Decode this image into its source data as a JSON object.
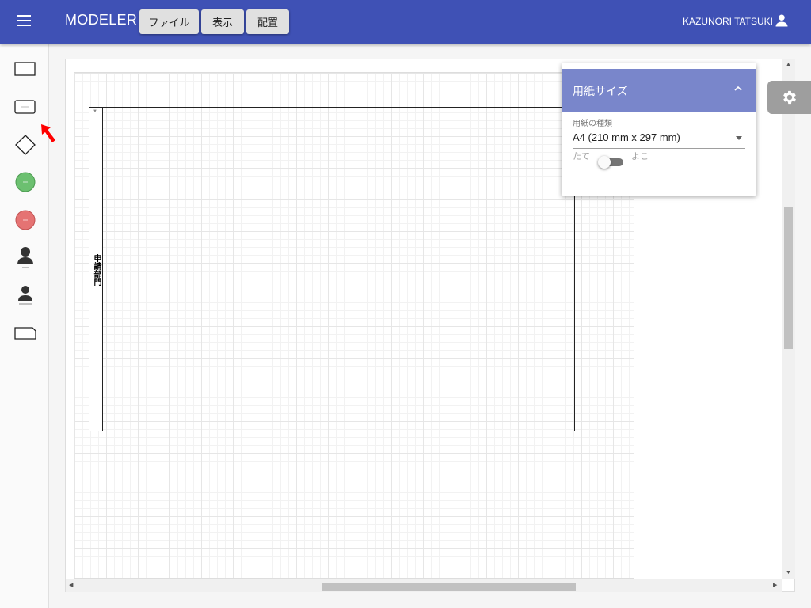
{
  "header": {
    "title": "MODELER",
    "menus": [
      {
        "label": "ファイル"
      },
      {
        "label": "表示"
      },
      {
        "label": "配置"
      }
    ],
    "user_name": "KAZUNORI TATSUKI"
  },
  "palette": {
    "items": [
      {
        "name": "rectangle-shape",
        "caption": ""
      },
      {
        "name": "rounded-rect-shape",
        "caption": ""
      },
      {
        "name": "diamond-shape",
        "caption": ""
      },
      {
        "name": "green-circle-shape",
        "caption": ""
      },
      {
        "name": "red-circle-shape",
        "caption": ""
      },
      {
        "name": "person-shape",
        "caption": ""
      },
      {
        "name": "person-shape-small",
        "caption": ""
      },
      {
        "name": "document-shape",
        "caption": ""
      }
    ]
  },
  "canvas": {
    "lane_label": "申請部門"
  },
  "paper_panel": {
    "title": "用紙サイズ",
    "type_label": "用紙の種類",
    "type_value": "A4 (210 mm x 297 mm)",
    "orientation_left": "たて",
    "orientation_right": "よこ",
    "landscape": false
  },
  "colors": {
    "appbar": "#3f51b5",
    "panel_header": "#7986cb",
    "green": "#6cc070",
    "red": "#e57373",
    "arrow": "#ff0000"
  }
}
